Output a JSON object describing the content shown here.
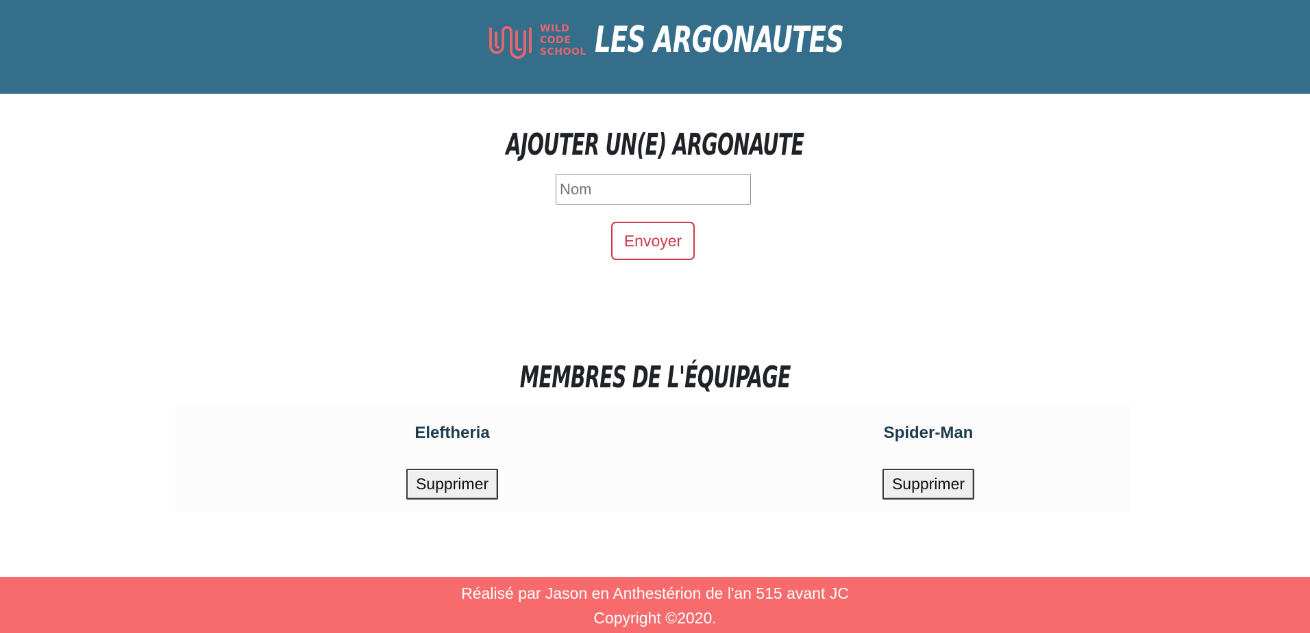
{
  "header": {
    "logo_lines": [
      "WILD",
      "CODE",
      "SCHOOL"
    ],
    "site_title": "Les Argonautes",
    "brand_color": "#346e8b",
    "logo_color": "#e46670"
  },
  "add_section": {
    "title": "Ajouter un(e) Argonaute",
    "name_input": {
      "value": "",
      "placeholder": "Nom"
    },
    "submit_label": "Envoyer",
    "accent_color": "#cc3a47"
  },
  "crew_section": {
    "title": "Membres de l'équipage",
    "members": [
      {
        "name": "Eleftheria",
        "delete_label": "Supprimer"
      },
      {
        "name": "Spider-Man",
        "delete_label": "Supprimer"
      }
    ]
  },
  "footer": {
    "credit": "Réalisé par Jason en Anthestérion de l'an 515 avant JC",
    "copyright": "Copyright ©2020.",
    "background_color": "#f76b6d"
  }
}
